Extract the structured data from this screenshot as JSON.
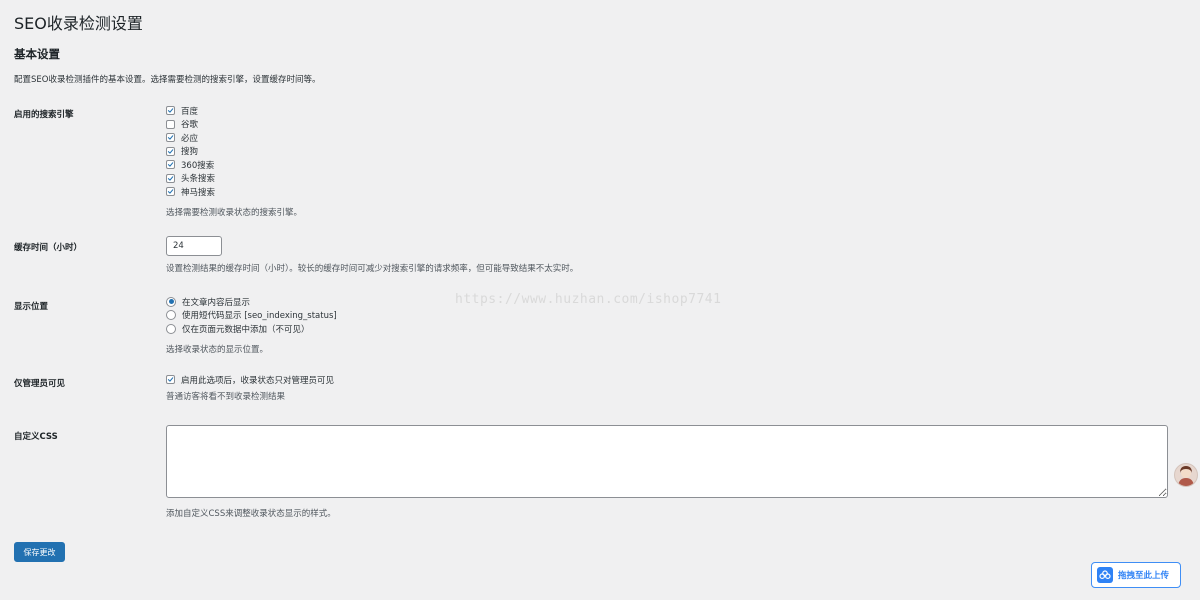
{
  "page": {
    "title": "SEO收录检测设置"
  },
  "basic": {
    "section_title": "基本设置",
    "description": "配置SEO收录检测插件的基本设置。选择需要检测的搜索引擎，设置缓存时间等。"
  },
  "engines": {
    "label": "启用的搜索引擎",
    "options": [
      {
        "label": "百度",
        "checked": true
      },
      {
        "label": "谷歌",
        "checked": false
      },
      {
        "label": "必应",
        "checked": true
      },
      {
        "label": "搜狗",
        "checked": true
      },
      {
        "label": "360搜索",
        "checked": true
      },
      {
        "label": "头条搜索",
        "checked": true
      },
      {
        "label": "神马搜索",
        "checked": true
      }
    ],
    "description": "选择需要检测收录状态的搜索引擎。"
  },
  "cache": {
    "label": "缓存时间（小时）",
    "value": "24",
    "description": "设置检测结果的缓存时间（小时）。较长的缓存时间可减少对搜索引擎的请求频率，但可能导致结果不太实时。"
  },
  "display": {
    "label": "显示位置",
    "options": [
      {
        "label": "在文章内容后显示",
        "selected": true
      },
      {
        "label": "使用短代码显示 [seo_indexing_status]",
        "selected": false
      },
      {
        "label": "仅在页面元数据中添加（不可见）",
        "selected": false
      }
    ],
    "description": "选择收录状态的显示位置。"
  },
  "admin_only": {
    "label": "仅管理员可见",
    "option_label": "启用此选项后，收录状态只对管理员可见",
    "checked": true,
    "description": "普通访客将看不到收录检测结果"
  },
  "custom_css": {
    "label": "自定义CSS",
    "value": "",
    "description": "添加自定义CSS来调整收录状态显示的样式。"
  },
  "actions": {
    "save_label": "保存更改"
  },
  "watermark": "https://www.huzhan.com/ishop7741",
  "upload_widget": {
    "label": "拖拽至此上传",
    "icon": "cloud-upload-icon"
  },
  "colors": {
    "primary": "#2271b1",
    "background": "#f0f0f1",
    "upload_accent": "#2f82f5"
  }
}
